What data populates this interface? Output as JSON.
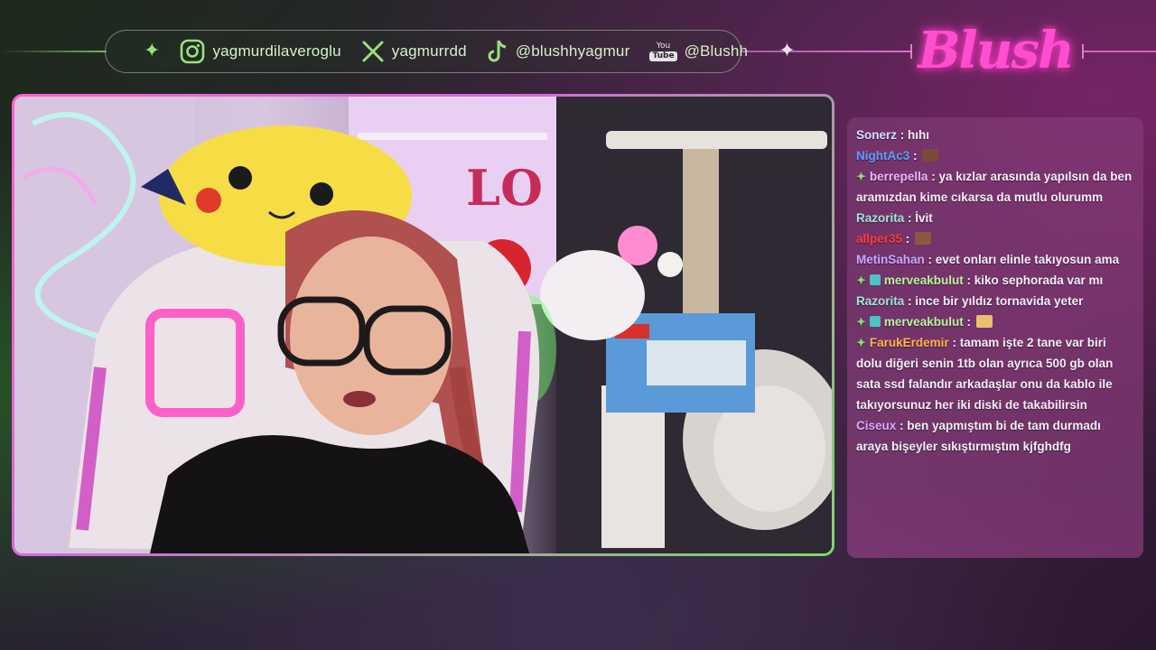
{
  "socials": [
    {
      "platform": "instagram",
      "icon": "instagram-icon",
      "handle": "yagmurdilaveroglu"
    },
    {
      "platform": "x",
      "icon": "x-icon",
      "handle": "yagmurrdd"
    },
    {
      "platform": "tiktok",
      "icon": "tiktok-icon",
      "handle": "@blushhyagmur"
    },
    {
      "platform": "youtube",
      "icon": "youtube-icon",
      "handle": "@Blushh",
      "logo_top": "You",
      "logo_bottom": "Tube"
    }
  ],
  "logo": {
    "text": "Blush"
  },
  "colors": {
    "accent_pink": "#ff4fcf",
    "accent_green": "#7fe06a",
    "chat_bg": "#9a4a8c"
  },
  "chat": {
    "messages": [
      {
        "user": "Sonerz",
        "color": "#cfe3ff",
        "text": "hıhı",
        "badges": []
      },
      {
        "user": "NightAc3",
        "color": "#5aa0ff",
        "text": "",
        "emote": "#7a4a3a",
        "badges": []
      },
      {
        "user": "berrepella",
        "color": "#e8b8ff",
        "text": "ya kızlar arasında yapılsın da ben aramızdan kime cıkarsa da mutlu olurumm",
        "badges": [
          "star"
        ]
      },
      {
        "user": "Razorita",
        "color": "#9fe6d4",
        "text": "İvit",
        "badges": []
      },
      {
        "user": "allper35",
        "color": "#ff3a3a",
        "text": "",
        "emote": "#8a5a40",
        "badges": []
      },
      {
        "user": "MetinSahan",
        "color": "#c9a8ff",
        "text": "evet onları elinle takıyosun ama",
        "badges": []
      },
      {
        "user": "merveakbulut",
        "color": "#b6f59a",
        "text": "kiko sephorada var mı",
        "badges": [
          "star",
          "sub"
        ]
      },
      {
        "user": "Razorita",
        "color": "#9fe6d4",
        "text": "ince bir yıldız tornavida yeter",
        "badges": []
      },
      {
        "user": "merveakbulut",
        "color": "#b6f59a",
        "text": "",
        "emote": "#e8c070",
        "badges": [
          "star",
          "sub"
        ]
      },
      {
        "user": "FarukErdemir",
        "color": "#ffb347",
        "text": "tamam işte 2 tane var biri dolu diğeri senin 1tb olan ayrıca 500 gb olan sata ssd falandır arkadaşlar onu da kablo ile takıyorsunuz her iki diski de takabilirsin",
        "badges": [
          "star"
        ]
      },
      {
        "user": "Ciseux",
        "color": "#dca8ff",
        "text": "ben yapmıştım bi de tam durmadı araya bişeyler sıkıştırmıştım kjfghdfg",
        "badges": []
      }
    ]
  }
}
